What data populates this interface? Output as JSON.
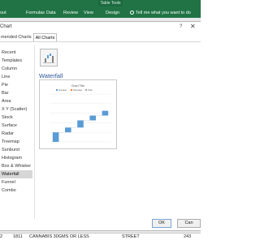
{
  "ribbon": {
    "context_group": "Table Tools",
    "tabs": [
      "out",
      "Formulas",
      "Data",
      "Review",
      "View",
      "Design"
    ],
    "tell_me": "Tell me what you want to do",
    "accent": "#217346"
  },
  "dialog": {
    "title": "Chart",
    "help": "?",
    "close": "✕",
    "tabs": [
      "mended Charts",
      "All Charts"
    ],
    "categories": [
      "Recent",
      "Templates",
      "Column",
      "Line",
      "Pie",
      "Bar",
      "Area",
      "X Y (Scatter)",
      "Stock",
      "Surface",
      "Radar",
      "Treemap",
      "Sunburst",
      "Histogram",
      "Box & Whisker",
      "Waterfall",
      "Funnel",
      "Combo"
    ],
    "selected_category": "Waterfall",
    "chart_heading": "Waterfall",
    "thumb_icon": "waterfall-chart-icon",
    "buttons": {
      "ok": "OK",
      "cancel": "Can"
    }
  },
  "preview": {
    "title": "Chart Title",
    "legend": [
      "Increase",
      "Decrease",
      "Total"
    ],
    "bar_color": "#5b9bd5",
    "chart_data": {
      "type": "bar",
      "subtype": "waterfall",
      "categories": [
        "1",
        "2",
        "3",
        "4",
        "5"
      ],
      "series": [
        {
          "name": "Increase",
          "values": [
            4,
            2,
            3,
            2,
            2
          ]
        }
      ],
      "y_start": [
        0,
        4,
        6,
        9,
        11
      ],
      "ylim": [
        0,
        20
      ]
    }
  },
  "worksheet": {
    "row": [
      "2",
      "1811",
      "CANNABIS 30GMS OR LESS",
      "STREET",
      "243"
    ]
  }
}
